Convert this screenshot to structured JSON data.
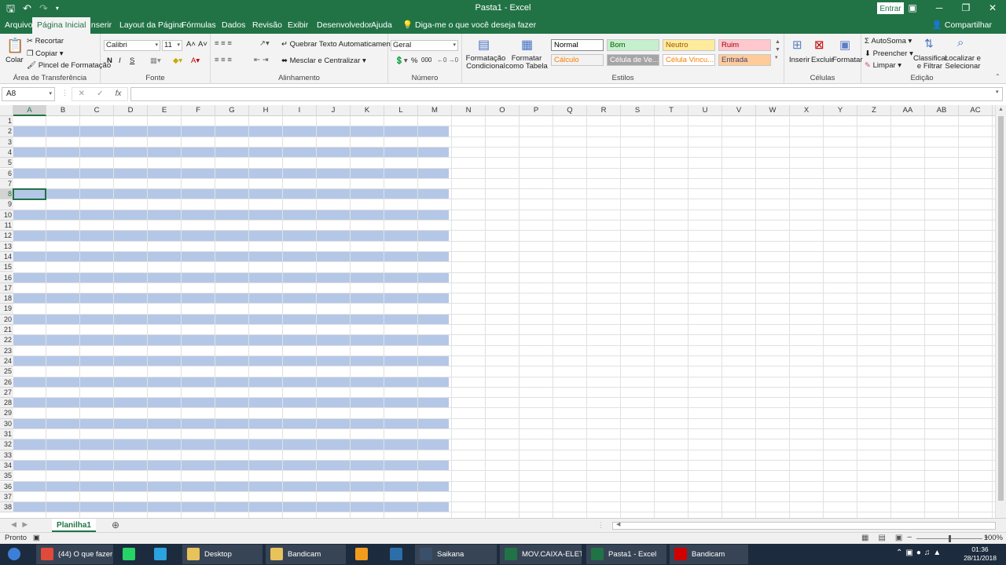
{
  "app": {
    "window_title": "Pasta1  -  Excel",
    "signin_label": "Entrar",
    "share_label": "Compartilhar"
  },
  "tabs": [
    "Arquivo",
    "Página Inicial",
    "Inserir",
    "Layout da Página",
    "Fórmulas",
    "Dados",
    "Revisão",
    "Exibir",
    "Desenvolvedor",
    "Ajuda"
  ],
  "active_tab": "Página Inicial",
  "tell_me": "Diga-me o que você deseja fazer",
  "ribbon": {
    "clipboard": {
      "group_label": "Área de Transferência",
      "paste": "Colar",
      "cut": "Recortar",
      "copy": "Copiar",
      "format_painter": "Pincel de Formatação"
    },
    "font": {
      "group_label": "Fonte",
      "font_name": "Calibri",
      "font_size": "11",
      "bold": "N",
      "italic": "I",
      "underline": "S"
    },
    "alignment": {
      "group_label": "Alinhamento",
      "wrap_text": "Quebrar Texto Automaticamente",
      "merge_center": "Mesclar e Centralizar"
    },
    "number": {
      "group_label": "Número",
      "format": "Geral",
      "percent": "%",
      "thousands": "000"
    },
    "styles": {
      "group_label": "Estilos",
      "conditional": "Formatação Condicional",
      "format_table": "Formatar como Tabela",
      "cells": [
        {
          "label": "Normal",
          "bg": "#ffffff",
          "fg": "#000000"
        },
        {
          "label": "Bom",
          "bg": "#c6efce",
          "fg": "#006100"
        },
        {
          "label": "Neutro",
          "bg": "#ffeb9c",
          "fg": "#9c5700"
        },
        {
          "label": "Ruim",
          "bg": "#ffc7ce",
          "fg": "#9c0006"
        },
        {
          "label": "Cálculo",
          "bg": "#f2f2f2",
          "fg": "#fa7d00"
        },
        {
          "label": "Célula de Ve...",
          "bg": "#a5a5a5",
          "fg": "#ffffff"
        },
        {
          "label": "Célula Vincu...",
          "bg": "#ffffff",
          "fg": "#fa7d00"
        },
        {
          "label": "Entrada",
          "bg": "#ffcc99",
          "fg": "#3f3f76"
        }
      ]
    },
    "cells_group": {
      "group_label": "Células",
      "insert": "Inserir",
      "delete": "Excluir",
      "format": "Formatar"
    },
    "editing": {
      "group_label": "Edição",
      "autosum": "AutoSoma",
      "fill": "Preencher",
      "clear": "Limpar",
      "sort_filter": "Classificar e Filtrar",
      "find_select": "Localizar e Selecionar"
    }
  },
  "formula_bar": {
    "name_box": "A8",
    "fx": "fx",
    "content": ""
  },
  "columns": [
    "A",
    "B",
    "C",
    "D",
    "E",
    "F",
    "G",
    "H",
    "I",
    "J",
    "K",
    "L",
    "M",
    "N",
    "O",
    "P",
    "Q",
    "R",
    "S",
    "T",
    "U",
    "V",
    "W",
    "X",
    "Y",
    "Z",
    "AA",
    "AB",
    "AC"
  ],
  "rows": [
    "1",
    "2",
    "3",
    "4",
    "5",
    "6",
    "7",
    "8",
    "9",
    "10",
    "11",
    "12",
    "13",
    "14",
    "15",
    "16",
    "17",
    "18",
    "19",
    "20",
    "21",
    "22",
    "23",
    "24",
    "25",
    "26",
    "27",
    "28",
    "29",
    "30",
    "31",
    "32",
    "33",
    "34",
    "35",
    "36",
    "37",
    "38"
  ],
  "banded_range": "A:M",
  "band_color": "#b4c7e7",
  "selected_cell": "A8",
  "sheet": {
    "tab_name": "Planilha1"
  },
  "status": {
    "ready": "Pronto",
    "zoom": "100%"
  },
  "taskbar": {
    "items": [
      {
        "label": "(44) O que fazer d...",
        "icon": "chrome-icon",
        "color": "#e04a3a"
      },
      {
        "label": "",
        "icon": "whatsapp-icon",
        "color": "#25d366"
      },
      {
        "label": "",
        "icon": "telegram-icon",
        "color": "#2aa3df"
      },
      {
        "label": "Desktop",
        "icon": "folder-icon",
        "color": "#e8c25a"
      },
      {
        "label": "Bandicam",
        "icon": "folder-icon",
        "color": "#e8c25a"
      },
      {
        "label": "",
        "icon": "media-player-icon",
        "color": "#f29b1d"
      },
      {
        "label": "",
        "icon": "photoshop-icon",
        "color": "#2c6ea8"
      },
      {
        "label": "Saikana",
        "icon": "steam-icon",
        "color": "#3a4f6a"
      },
      {
        "label": "MOV.CAIXA-ELET...",
        "icon": "excel-icon",
        "color": "#217346"
      },
      {
        "label": "Pasta1 - Excel",
        "icon": "excel-icon",
        "color": "#217346"
      },
      {
        "label": "Bandicam",
        "icon": "record-icon",
        "color": "#d00000"
      }
    ],
    "time": "01:36",
    "date": "28/11/2018"
  }
}
